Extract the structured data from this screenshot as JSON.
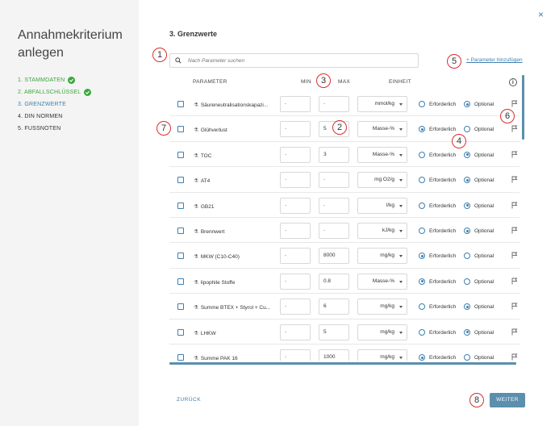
{
  "sidebar": {
    "title": "Annahmekriterium anlegen",
    "steps": [
      {
        "label": "1. STAMMDATEN",
        "state": "done"
      },
      {
        "label": "2. ABFALLSCHLÜSSEL",
        "state": "done"
      },
      {
        "label": "3. GRENZWERTE",
        "state": "current"
      },
      {
        "label": "4. DIN NORMEN",
        "state": "todo"
      },
      {
        "label": "5. FUSSNOTEN",
        "state": "todo"
      }
    ]
  },
  "main": {
    "close_icon": "×",
    "section_title": "3. Grenzwerte",
    "search_placeholder": "Nach Parameter suchen",
    "add_parameter": "+ Parameter hinzufügen",
    "columns": {
      "parameter": "PARAMETER",
      "min": "MIN",
      "max": "MAX",
      "unit": "EINHEIT",
      "info": "i"
    },
    "radio_labels": {
      "required": "Erforderlich",
      "optional": "Optional"
    },
    "rows": [
      {
        "name": "Säureneutralisationskapazi...",
        "min": "-",
        "max": "-",
        "unit": "mmol/kg",
        "requirement": "optional"
      },
      {
        "name": "Glühverlust",
        "min": "-",
        "max": "5",
        "unit": "Masse-%",
        "requirement": "required"
      },
      {
        "name": "TOC",
        "min": "-",
        "max": "3",
        "unit": "Masse-%",
        "requirement": "optional"
      },
      {
        "name": "AT4",
        "min": "-",
        "max": "-",
        "unit": "mg O2/g",
        "requirement": "optional"
      },
      {
        "name": "GB21",
        "min": "-",
        "max": "-",
        "unit": "l/kg",
        "requirement": "optional"
      },
      {
        "name": "Brennwert",
        "min": "-",
        "max": "-",
        "unit": "kJ/kg",
        "requirement": "optional"
      },
      {
        "name": "MKW (C10-C40)",
        "min": "-",
        "max": "8000",
        "unit": "mg/kg",
        "requirement": "required"
      },
      {
        "name": "lipophile Stoffe",
        "min": "-",
        "max": "0.8",
        "unit": "Masse-%",
        "requirement": "required"
      },
      {
        "name": "Summe BTEX + Styrol + Cu...",
        "min": "-",
        "max": "6",
        "unit": "mg/kg",
        "requirement": "optional"
      },
      {
        "name": "LHKW",
        "min": "-",
        "max": "5",
        "unit": "mg/kg",
        "requirement": "optional"
      },
      {
        "name": "Summe PAK 16",
        "min": "-",
        "max": "1000",
        "unit": "mg/kg",
        "requirement": "required"
      }
    ],
    "back_label": "ZURÜCK",
    "next_label": "WEITER"
  },
  "markers": [
    "1",
    "2",
    "3",
    "4",
    "5",
    "6",
    "7",
    "8"
  ],
  "colors": {
    "accent": "#3f7fae",
    "success": "#3aa83a",
    "marker": "#d6302e",
    "button": "#5b8fad"
  }
}
